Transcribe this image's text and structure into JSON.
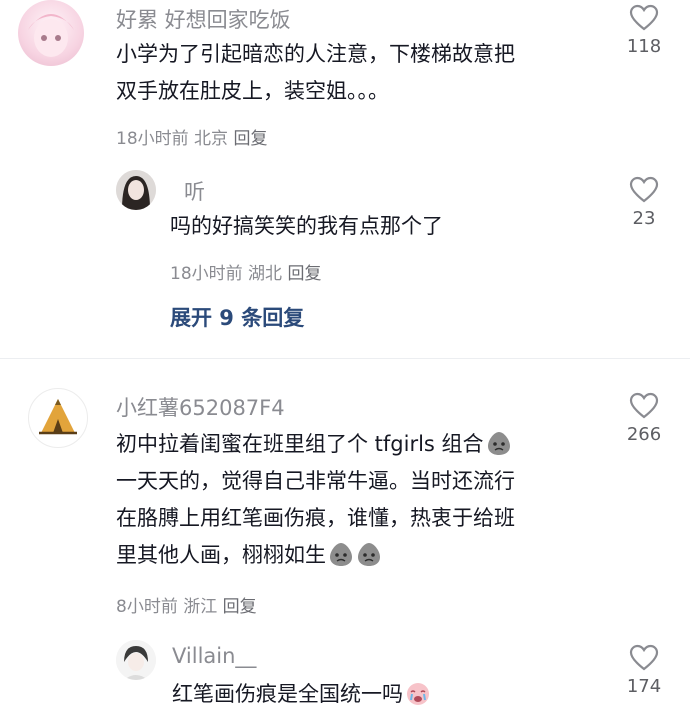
{
  "comments": [
    {
      "username": "好累  好想回家吃饭",
      "lines": [
        "小学为了引起暗恋的人注意，下楼梯故意把",
        "双手放在肚皮上，装空姐。。。"
      ],
      "time": "18小时前",
      "location": "北京",
      "reply_label": "回复",
      "likes": "118"
    },
    {
      "username": "听",
      "lines": [
        "吗的好搞笑笑的我有点那个了"
      ],
      "time": "18小时前",
      "location": "湖北",
      "reply_label": "回复",
      "likes": "23"
    },
    {
      "username": "小红薯652087F4",
      "lines": [
        "初中拉着闺蜜在班里组了个 tfgirls 组合",
        "一天天的，觉得自己非常牛逼。当时还流行",
        "在胳膊上用红笔画伤痕，谁懂，热衷于给班",
        "里其他人画，栩栩如生"
      ],
      "time": "8小时前",
      "location": "浙江",
      "reply_label": "回复",
      "likes": "266"
    },
    {
      "username": "Villain__",
      "lines": [
        "红笔画伤痕是全国统一吗"
      ],
      "likes": "174"
    }
  ],
  "expand_replies": "展开 9 条回复",
  "colors": {
    "like_icon": "#8a8b91",
    "expand_link": "#2b4a7a",
    "secondary_text": "#8a8b91"
  }
}
